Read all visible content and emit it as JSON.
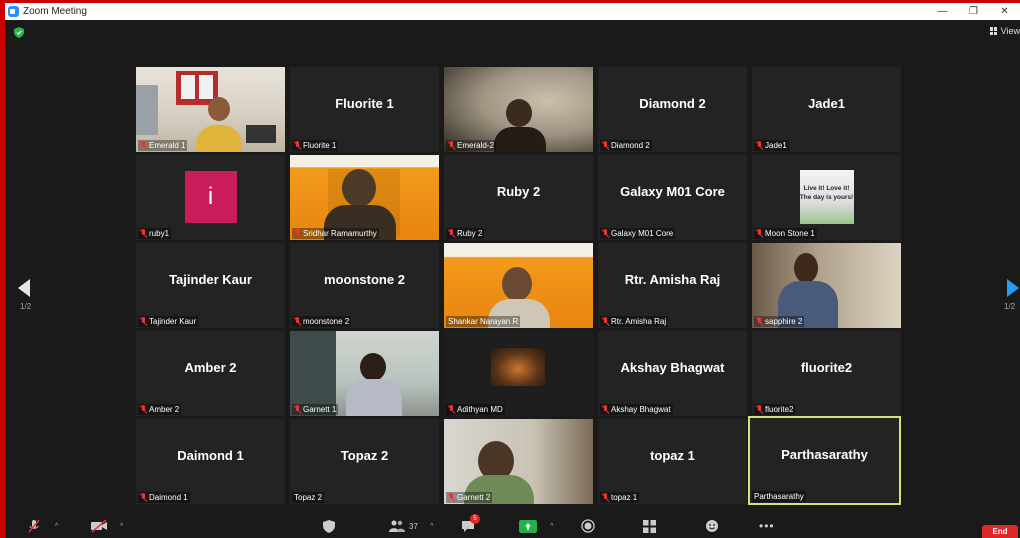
{
  "window": {
    "title": "Zoom Meeting",
    "min": "—",
    "restore": "❐",
    "close": "✕"
  },
  "top": {
    "view_label": "View"
  },
  "nav": {
    "left_page": "1/2",
    "right_page": "1/2"
  },
  "tiles": [
    {
      "label": "Emerald 1",
      "big": ""
    },
    {
      "label": "Fluorite 1",
      "big": "Fluorite 1"
    },
    {
      "label": "Emerald-2",
      "big": ""
    },
    {
      "label": "Diamond 2",
      "big": "Diamond 2"
    },
    {
      "label": "Jade1",
      "big": "Jade1"
    },
    {
      "label": "ruby1",
      "big": "",
      "avatar": "i"
    },
    {
      "label": "Sridhar Ramamurthy",
      "big": ""
    },
    {
      "label": "Ruby 2",
      "big": "Ruby 2"
    },
    {
      "label": "Galaxy M01 Core",
      "big": "Galaxy M01 Core"
    },
    {
      "label": "Moon Stone 1",
      "big": "",
      "avatar_text": "Live it! Love it! The day is yours!"
    },
    {
      "label": "Tajinder Kaur",
      "big": "Tajinder Kaur"
    },
    {
      "label": "moonstone 2",
      "big": "moonstone 2"
    },
    {
      "label": "Shankar Narayan R",
      "big": ""
    },
    {
      "label": "Rtr. Amisha Raj",
      "big": "Rtr. Amisha Raj"
    },
    {
      "label": "sapphire 2",
      "big": ""
    },
    {
      "label": "Amber 2",
      "big": "Amber 2"
    },
    {
      "label": "Garnett 1",
      "big": ""
    },
    {
      "label": "Adithyan MD",
      "big": ""
    },
    {
      "label": "Akshay Bhagwat",
      "big": "Akshay Bhagwat"
    },
    {
      "label": "fluorite2",
      "big": "fluorite2"
    },
    {
      "label": "Daimond 1",
      "big": "Daimond 1"
    },
    {
      "label": "Topaz 2",
      "big": "Topaz 2"
    },
    {
      "label": "Garnett 2",
      "big": ""
    },
    {
      "label": "topaz 1",
      "big": "topaz 1"
    },
    {
      "label": "Parthasarathy",
      "big": "Parthasarathy"
    }
  ],
  "toolbar": {
    "participants_count": "37",
    "chat_badge": "5",
    "end_label": "End"
  },
  "colors": {
    "active_speaker_border": "#c8e87a",
    "end_button": "#e02828",
    "accent_blue": "#2d8cff",
    "window_frame": "#cc0000"
  }
}
